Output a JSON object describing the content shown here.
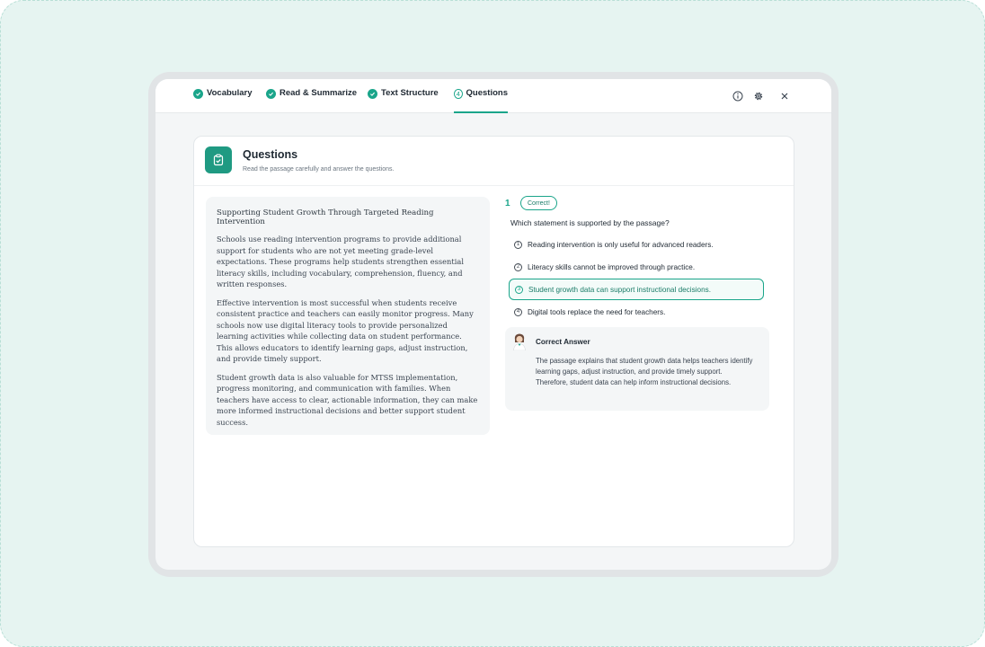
{
  "tabs": [
    {
      "label": "Vocabulary",
      "state": "done"
    },
    {
      "label": "Read & Summarize",
      "state": "done"
    },
    {
      "label": "Text Structure",
      "state": "done"
    },
    {
      "label": "Questions",
      "state": "active",
      "number": "4"
    }
  ],
  "toolbar_icons": [
    "info-icon",
    "gear-icon",
    "close-icon"
  ],
  "header": {
    "title": "Questions",
    "subtitle": "Read the passage carefully and answer the questions."
  },
  "passage": {
    "title": "Supporting Student Growth Through Targeted Reading Intervention",
    "paragraphs": [
      "Schools use reading intervention programs to provide additional support for students who are not yet meeting grade-level expectations. These programs help students strengthen essential literacy skills, including vocabulary, comprehension, fluency, and written responses.",
      "Effective intervention is most successful when students receive consistent practice and teachers can easily monitor progress. Many schools now use digital literacy tools to provide personalized learning activities while collecting data on student performance. This allows educators to identify learning gaps, adjust instruction, and provide timely support.",
      "Student growth data is also valuable for MTSS implementation, progress monitoring, and communication with families. When teachers have access to clear, actionable information, they can make more informed instructional decisions and better support student success."
    ]
  },
  "question": {
    "number": "1",
    "badge": "Correct!",
    "text": "Which statement is supported by the passage?",
    "options": [
      {
        "num": "1",
        "text": "Reading intervention is only useful for advanced readers."
      },
      {
        "num": "2",
        "text": "Literacy skills cannot be improved through practice."
      },
      {
        "num": "3",
        "text": "Student growth data can support instructional decisions.",
        "selected": true
      },
      {
        "num": "4",
        "text": "Digital tools replace the need for teachers."
      }
    ]
  },
  "answer": {
    "title": "Correct Answer",
    "body": "The passage explains that student growth data helps teachers identify learning gaps, adjust instruction, and provide timely support. Therefore, student data can help inform instructional decisions."
  },
  "colors": {
    "accent": "#1aa58a",
    "background": "#e6f4f1"
  }
}
